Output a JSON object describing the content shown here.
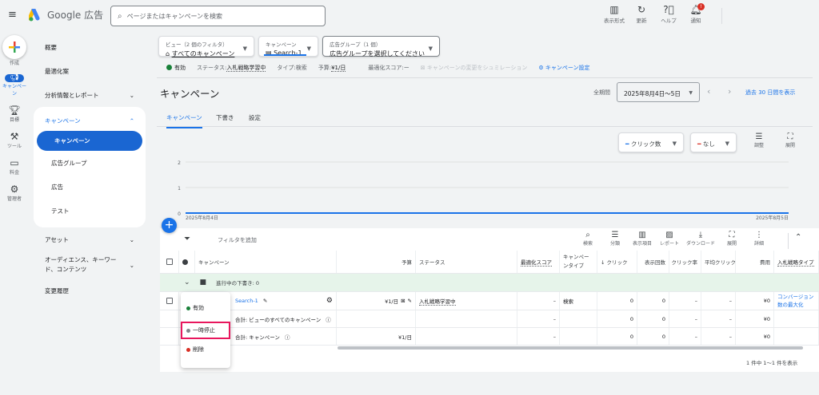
{
  "header": {
    "product": "Google 広告",
    "search_placeholder": "ページまたはキャンペーンを検索",
    "actions": [
      {
        "label": "表示形式",
        "icon": "appearance-icon"
      },
      {
        "label": "更新",
        "icon": "refresh-icon"
      },
      {
        "label": "ヘルプ",
        "icon": "help-icon"
      },
      {
        "label": "通知",
        "icon": "bell-icon",
        "badge": "!"
      }
    ]
  },
  "rail": [
    {
      "label": "作成",
      "icon": "plus-icon"
    },
    {
      "label": "キャンペーン",
      "icon": "megaphone-icon"
    },
    {
      "label": "目標",
      "icon": "trophy-icon"
    },
    {
      "label": "ツール",
      "icon": "tools-icon"
    },
    {
      "label": "料金",
      "icon": "card-icon"
    },
    {
      "label": "管理者",
      "icon": "gear-icon"
    }
  ],
  "nav": {
    "overview": "概要",
    "recommendations": "最適化案",
    "insights": "分析情報とレポート",
    "campaigns_group": "キャンペーン",
    "sub": [
      "キャンペーン",
      "広告グループ",
      "広告",
      "テスト"
    ],
    "assets": "アセット",
    "audiences": "オーディエンス、キーワード、コンテンツ",
    "history": "変更履歴"
  },
  "filters": {
    "view_label": "ビュー（2 個のフィルタ）",
    "view_value": "すべてのキャンペーン",
    "campaign_label": "キャンペーン",
    "campaign_value": "Search-1",
    "adgroup_label": "広告グループ（1 個）",
    "adgroup_value": "広告グループを選択してください"
  },
  "status_bar": {
    "enabled": "有効",
    "status_label": "ステータス:",
    "status_value": "入札戦略学習中",
    "type_label": "タイプ:",
    "type_value": "検索",
    "budget_label": "予算:",
    "budget_value": "¥1/日",
    "score_label": "最適化スコア:",
    "score_value": "ー",
    "simulate": "キャンペーンの変更をシュミレーション",
    "settings": "キャンペーン設定"
  },
  "page": {
    "title": "キャンペーン",
    "period_label": "全期間",
    "date_range": "2025年8月4日～5日",
    "last30": "過去 30 日間を表示",
    "tabs": [
      "キャンペーン",
      "下書き",
      "設定"
    ]
  },
  "chart_controls": {
    "metric1": "クリック数",
    "metric2": "なし",
    "adjust": "調整",
    "expand": "展開",
    "metric1_color": "#1a73e8",
    "metric2_color": "#d93025"
  },
  "chart_data": {
    "type": "line",
    "series": [
      {
        "name": "クリック数",
        "values": [
          0,
          0
        ]
      }
    ],
    "x": [
      "2025年8月4日",
      "2025年8月5日"
    ],
    "ylim": [
      0,
      2
    ],
    "yticks": [
      "0",
      "1",
      "2"
    ]
  },
  "table": {
    "filter": "フィルタを追加",
    "tools": [
      {
        "label": "検索",
        "icon": "search-icon"
      },
      {
        "label": "分類",
        "icon": "segment-icon"
      },
      {
        "label": "表示項目",
        "icon": "columns-icon"
      },
      {
        "label": "レポート",
        "icon": "report-icon"
      },
      {
        "label": "ダウンロード",
        "icon": "download-icon"
      },
      {
        "label": "展開",
        "icon": "expand-icon"
      },
      {
        "label": "詳細",
        "icon": "more-icon"
      }
    ],
    "headers": [
      "キャンペーン",
      "予算",
      "ステータス",
      "最適化スコア",
      "キャンペーンタイプ",
      "↓ クリック",
      "表示回数",
      "クリック率",
      "平均クリック",
      "費用",
      "入札戦略タイプ"
    ],
    "draft_row": "進行中の下書き: 0",
    "rows": [
      {
        "name": "Search-1",
        "budget": "¥1/日",
        "status": "入札戦略学習中",
        "score": "–",
        "type": "検索",
        "clicks": "0",
        "impr": "0",
        "ctr": "–",
        "cpc": "–",
        "cost": "¥0",
        "bid": "コンバージョン数の最大化"
      },
      {
        "name": "合計: ビューのすべてのキャンペーン",
        "budget": "",
        "status": "",
        "score": "–",
        "type": "",
        "clicks": "0",
        "impr": "0",
        "ctr": "–",
        "cpc": "–",
        "cost": "¥0",
        "bid": ""
      },
      {
        "name": "合計: キャンペーン",
        "budget": "¥1/日",
        "status": "",
        "score": "–",
        "type": "",
        "clicks": "0",
        "impr": "0",
        "ctr": "–",
        "cpc": "–",
        "cost": "¥0",
        "bid": ""
      }
    ],
    "footer": "1 件中 1～1 件を表示"
  },
  "status_menu": {
    "items": [
      "有効",
      "一時停止",
      "削除"
    ],
    "highlighted": "一時停止"
  }
}
